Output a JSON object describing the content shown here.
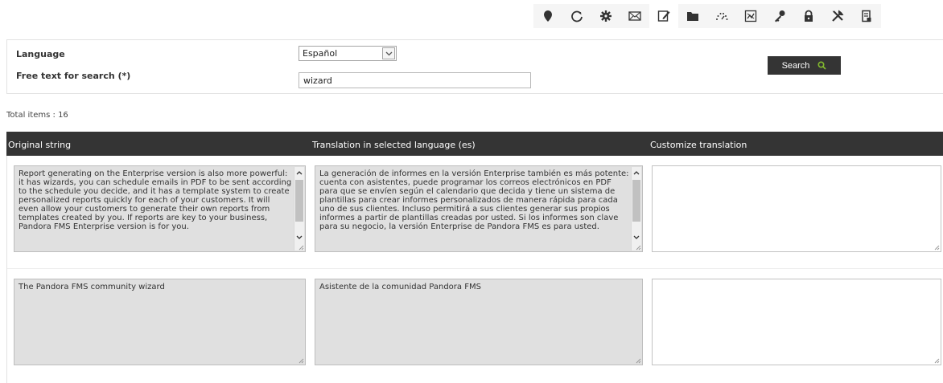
{
  "toolbar": {
    "icons": [
      {
        "name": "map-marker-icon",
        "active": false
      },
      {
        "name": "refresh-icon",
        "active": false
      },
      {
        "name": "gear-icon",
        "active": false
      },
      {
        "name": "envelope-icon",
        "active": false
      },
      {
        "name": "edit-note-icon",
        "active": true
      },
      {
        "name": "folder-icon",
        "active": false
      },
      {
        "name": "gauge-icon",
        "active": false
      },
      {
        "name": "chart-icon",
        "active": false
      },
      {
        "name": "key-icon",
        "active": false
      },
      {
        "name": "lock-icon",
        "active": false
      },
      {
        "name": "tools-icon",
        "active": false
      },
      {
        "name": "clipboard-icon",
        "active": false
      }
    ]
  },
  "search": {
    "language_label": "Language",
    "language_value": "Español",
    "free_text_label": "Free text for search (*)",
    "free_text_value": "wizard",
    "button_label": "Search"
  },
  "total_items": "Total items : 16",
  "table": {
    "headers": [
      "Original string",
      "Translation in selected language (es)",
      "Customize translation"
    ],
    "rows": [
      {
        "original": "Report generating on the Enterprise version is also more powerful: it has wizards, you can schedule emails in PDF to be sent according to the schedule you decide, and it has a template system to create personalized reports quickly for each of your customers. It will even allow your customers to generate their own reports from templates created by you. If reports are key to your business, Pandora FMS Enterprise version is for you.",
        "translation": "La generación de informes en la versión Enterprise también es más potente: cuenta con asistentes, puede programar los correos electrónicos en PDF para que se envíen según el calendario que decida y tiene un sistema de plantillas para crear informes personalizados de manera rápida para cada uno de sus clientes. Incluso permitirá a sus clientes generar sus propios informes a partir de plantillas creadas por usted. Si los informes son clave para su negocio, la versión Enterprise de Pandora FMS es para usted.",
        "custom": ""
      },
      {
        "original": "The Pandora FMS community wizard",
        "translation": "Asistente de la comunidad Pandora FMS",
        "custom": ""
      }
    ]
  },
  "colors": {
    "header_bg": "#343434",
    "readonly_bg": "#e0e0e0",
    "accent_green": "#82b92e"
  }
}
